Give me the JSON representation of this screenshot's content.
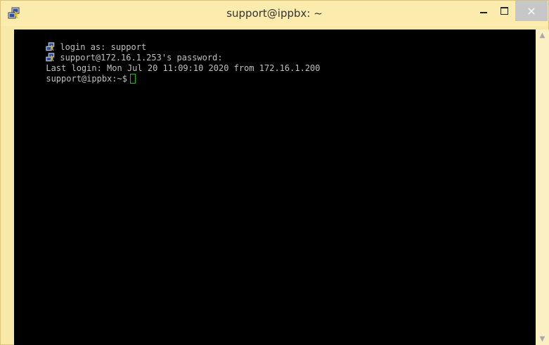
{
  "window": {
    "title": "support@ippbx: ~",
    "controls": {
      "minimize": "minimize",
      "maximize": "maximize",
      "close": "×"
    }
  },
  "terminal": {
    "lines": [
      {
        "icon": "putty-icon",
        "text": "login as: support"
      },
      {
        "icon": "putty-icon",
        "text": "support@172.16.1.253's password:"
      },
      {
        "icon": "",
        "text": "Last login: Mon Jul 20 11:09:10 2020 from 172.16.1.200"
      },
      {
        "icon": "",
        "text": "support@ippbx:~$"
      }
    ],
    "cursor_color": "#10c010",
    "text_color": "#c0c0c0",
    "background": "#000000"
  },
  "scrollbar": {
    "up_icon": "chevron-up-icon",
    "down_icon": "chevron-down-icon"
  },
  "colors": {
    "titlebar": "#fbecad",
    "close_button": "#c7c7c7"
  }
}
